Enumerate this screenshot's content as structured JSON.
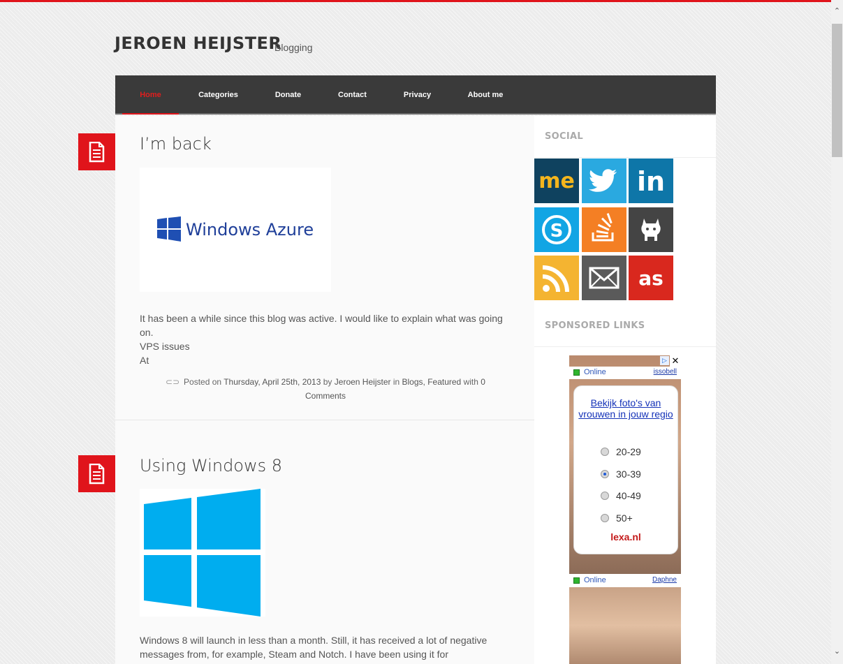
{
  "site": {
    "title": "JEROEN HEIJSTER",
    "tagline": "Blogging"
  },
  "nav": {
    "items": [
      {
        "label": "Home",
        "active": true
      },
      {
        "label": "Categories"
      },
      {
        "label": "Donate"
      },
      {
        "label": "Contact"
      },
      {
        "label": "Privacy"
      },
      {
        "label": "About me"
      }
    ]
  },
  "posts": [
    {
      "title": "I’m back",
      "image": "windows-azure-logo",
      "image_text": "Windows Azure",
      "excerpt": [
        "It has been a while since this blog was active. I would like to explain what was going on.",
        "VPS issues",
        "At"
      ],
      "meta": {
        "prefix": "Posted on",
        "date": "Thursday, April 25th, 2013",
        "by": "by",
        "author": "Jeroen Heijster",
        "in": "in",
        "categories": "Blogs, Featured",
        "with": "with",
        "comments": "0 Comments"
      }
    },
    {
      "title": "Using Windows 8",
      "image": "windows-8-logo",
      "excerpt": [
        "Windows 8 will launch in less than a month. Still, it has received a lot of negative messages from, for example, Steam and Notch. I have been using it for"
      ]
    }
  ],
  "sidebar": {
    "social_title": "SOCIAL",
    "social_icons": [
      "aboutme-icon",
      "twitter-icon",
      "linkedin-icon",
      "skype-icon",
      "stackoverflow-icon",
      "github-icon",
      "rss-icon",
      "email-icon",
      "lastfm-icon"
    ],
    "sponsored_title": "SPONSORED LINKS",
    "ad": {
      "status1": "Online",
      "name1": "issobell",
      "headline": "Bekijk foto's van vrouwen in jouw regio",
      "options": [
        "20-29",
        "30-39",
        "40-49",
        "50+"
      ],
      "selected": "30-39",
      "logo": "lexa.nl",
      "status2": "Online",
      "name2": "Daphne"
    }
  },
  "colors": {
    "accent": "#e0141b",
    "nav_bg": "#3a3a3a"
  }
}
